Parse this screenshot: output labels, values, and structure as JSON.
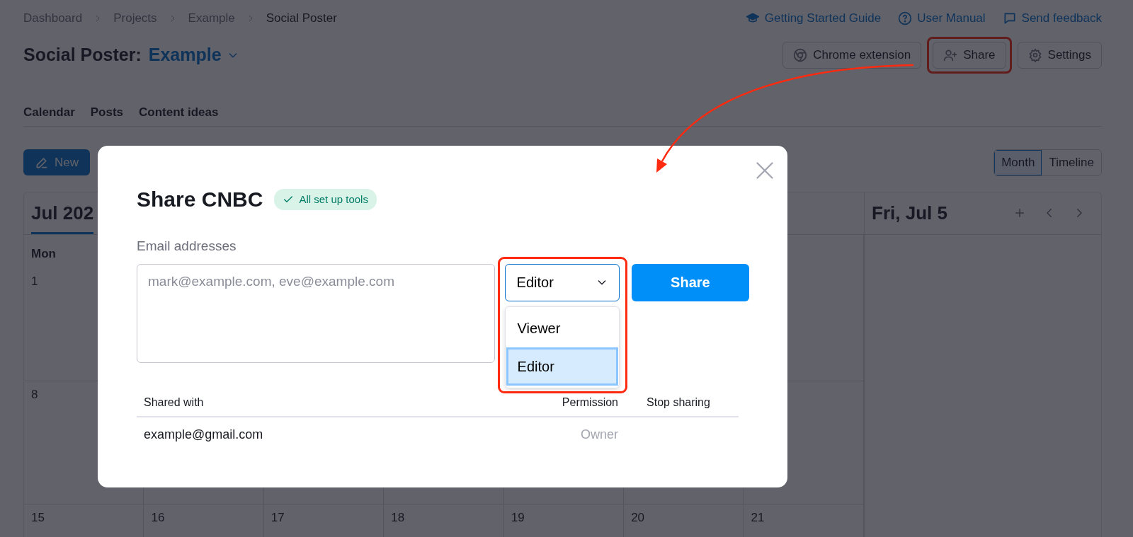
{
  "breadcrumbs": [
    {
      "label": "Dashboard",
      "current": false
    },
    {
      "label": "Projects",
      "current": false
    },
    {
      "label": "Example",
      "current": false
    },
    {
      "label": "Social Poster",
      "current": true
    }
  ],
  "help_links": [
    {
      "label": "Getting Started Guide",
      "kind": "guide"
    },
    {
      "label": "User Manual",
      "kind": "manual"
    },
    {
      "label": "Send feedback",
      "kind": "feedback"
    }
  ],
  "page_title": {
    "prefix": "Social Poster:",
    "project": "Example"
  },
  "header_buttons": [
    {
      "label": "Chrome extension",
      "kind": "chrome",
      "highlighted": false
    },
    {
      "label": "Share",
      "kind": "share",
      "highlighted": true
    },
    {
      "label": "Settings",
      "kind": "settings",
      "highlighted": false
    }
  ],
  "tabs": [
    {
      "label": "Calendar"
    },
    {
      "label": "Posts"
    },
    {
      "label": "Content ideas"
    }
  ],
  "new_button": {
    "label": "New"
  },
  "view_toggle": [
    {
      "label": "Month",
      "selected": true
    },
    {
      "label": "Timeline",
      "selected": false
    }
  ],
  "calendar": {
    "month_label": "Jul 202",
    "weekdays": [
      "Mon"
    ],
    "weeks": [
      [
        "1"
      ],
      [
        "8"
      ],
      [
        "15",
        "16",
        "17",
        "18",
        "19",
        "20",
        "21"
      ]
    ]
  },
  "day_panel": {
    "title": "Fri, Jul 5"
  },
  "dialog": {
    "title": "Share CNBC",
    "badge": "All set up tools",
    "email_label": "Email addresses",
    "email_field": {
      "placeholder": "mark@example.com, eve@example.com"
    },
    "permission_select": {
      "value": "Editor",
      "highlighted": true,
      "options": [
        {
          "label": "Viewer",
          "selected": false
        },
        {
          "label": "Editor",
          "selected": true
        }
      ]
    },
    "share_button": "Share",
    "table": {
      "columns": [
        "Shared with",
        "Permission",
        "Stop sharing"
      ],
      "rows": [
        {
          "email": "example@gmail.com",
          "permission": "Owner"
        }
      ]
    }
  }
}
